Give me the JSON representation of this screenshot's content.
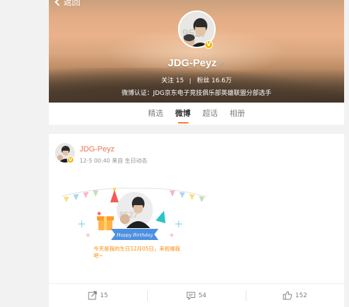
{
  "header": {
    "back_label": "返回",
    "name": "JDG-Peyz",
    "gender_symbol": "♂",
    "verified_mark": "V",
    "following_label": "关注",
    "following_count": "15",
    "followers_label": "粉丝",
    "followers_count": "16.6万",
    "verification": "微博认证：JDG京东电子竞技俱乐部英雄联盟分部选手"
  },
  "tabs": [
    {
      "label": "精选",
      "active": false
    },
    {
      "label": "微博",
      "active": true
    },
    {
      "label": "超话",
      "active": false
    },
    {
      "label": "相册",
      "active": false
    }
  ],
  "post": {
    "author": "JDG-Peyz",
    "meta": "12-5 00:40 来自 生日动态",
    "image": {
      "banner_text": "Happy Birthday",
      "message": "今天是我的生日12月05日，来祝福我吧~"
    }
  },
  "actions": {
    "repost_count": "15",
    "comment_count": "54",
    "like_count": "152"
  },
  "colors": {
    "accent": "#eb7350",
    "tab_underline": "#fa7d3c",
    "verified": "#f5b400",
    "birthday_text": "#ff8a00"
  }
}
